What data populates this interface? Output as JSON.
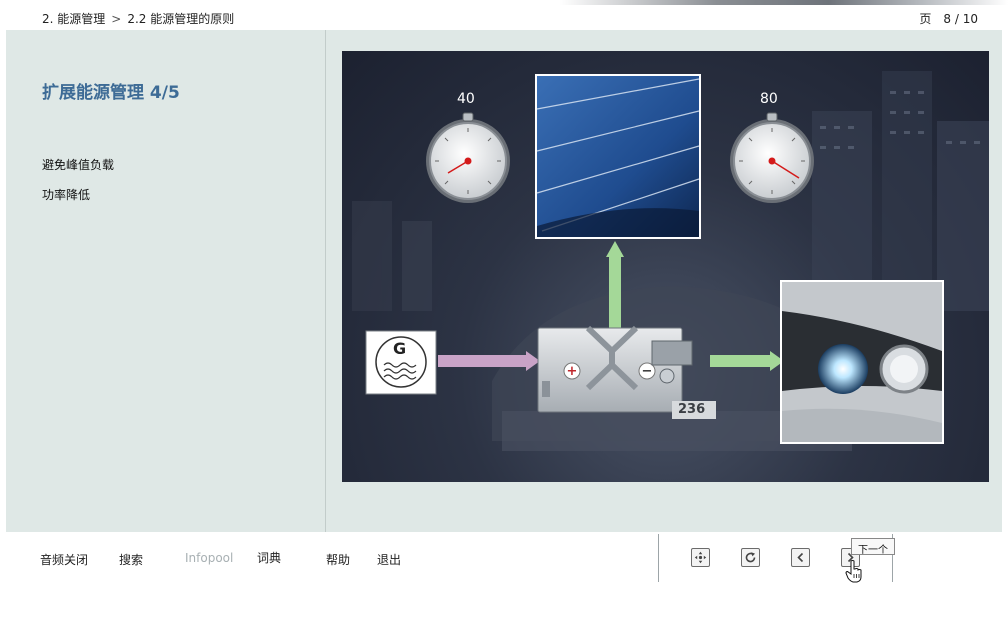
{
  "breadcrumb": {
    "chapter": "2. 能源管理",
    "separator": ">",
    "section": "2.2 能源管理的原则"
  },
  "pageinfo": {
    "label": "页",
    "value": "8 / 10"
  },
  "content": {
    "title": "扩展能源管理 4/5",
    "bullets": [
      "避免峰值负载",
      "功率降低"
    ]
  },
  "figure": {
    "gauge_left_value": "40",
    "gauge_right_value": "80",
    "generator_letter": "G",
    "plate_number": "236",
    "arrow_colors": {
      "generator": "#c9a3c7",
      "heater": "#a4d898",
      "lights": "#a4d898"
    }
  },
  "bottom_nav": {
    "audio_off": "音频关闭",
    "search": "搜索",
    "infopool": "Infopool",
    "glossary": "词典",
    "help": "帮助",
    "exit": "退出"
  },
  "controls": {
    "tooltip": "下一个",
    "icons": [
      "move-icon",
      "reload-icon",
      "previous-icon",
      "next-icon"
    ]
  }
}
